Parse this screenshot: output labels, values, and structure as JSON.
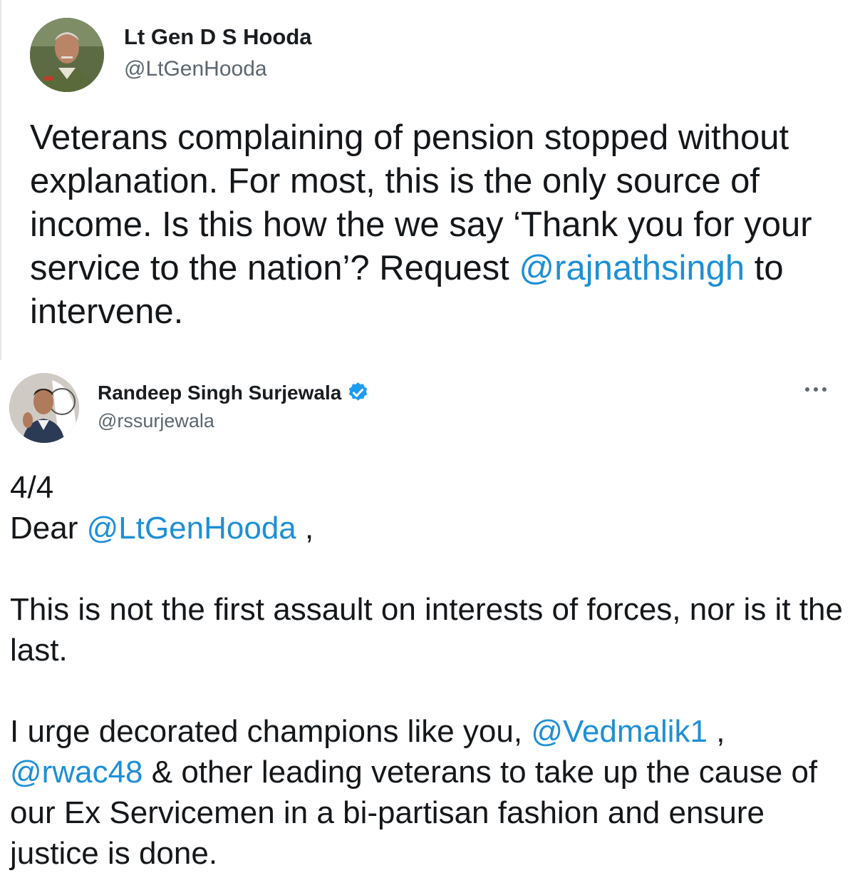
{
  "tweet1": {
    "author_name": "Lt Gen D S Hooda",
    "author_handle": "@LtGenHooda",
    "text": {
      "part1": "Veterans complaining of pension stopped without explanation. For most, this is the only source of income. Is this how the we say ‘Thank you for your service to the nation’? Request ",
      "mention1": "@rajnathsingh",
      "part2": " to intervene."
    }
  },
  "tweet2": {
    "author_name": "Randeep Singh Surjewala",
    "author_handle": "@rssurjewala",
    "verified": true,
    "more_icon": "more-options-icon",
    "text": {
      "thread_count": "4/4",
      "greeting_prefix": "Dear ",
      "greeting_mention": "@LtGenHooda",
      "greeting_suffix": " ,",
      "para2": "This is not the first assault on interests of forces, nor is it the last.",
      "para3_part1": "I urge decorated champions like you, ",
      "para3_mention1": "@Vedmalik1",
      "para3_part2": " ,\n",
      "para3_mention2": "@rwac48",
      "para3_part3": " & other leading veterans to take up the cause of our Ex Servicemen in a bi-partisan fashion and ensure justice is done."
    }
  },
  "colors": {
    "mention": "#1d8fd6",
    "verified_badge": "#1d9bf0",
    "handle": "#5b6670"
  }
}
